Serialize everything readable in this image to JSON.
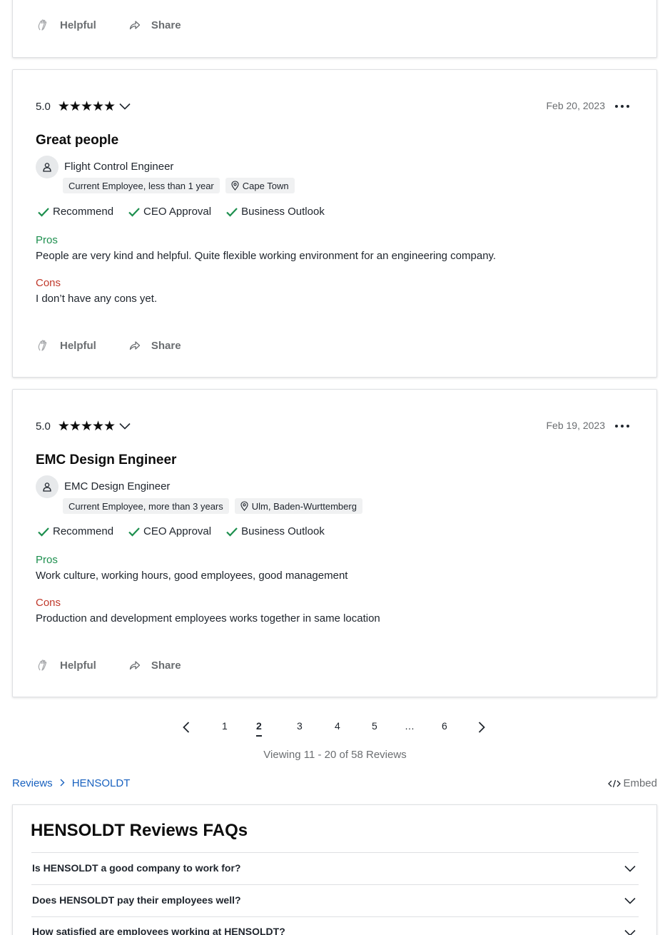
{
  "actions": {
    "helpful": "Helpful",
    "share": "Share"
  },
  "reviews": [
    {
      "rating": "5.0",
      "date": "Feb 20, 2023",
      "title": "Great people",
      "job_title": "Flight Control Engineer",
      "employment": "Current Employee, less than 1 year",
      "location": "Cape Town",
      "checks": [
        "Recommend",
        "CEO Approval",
        "Business Outlook"
      ],
      "pros_label": "Pros",
      "pros": "People are very kind and helpful. Quite flexible working environment for an engineering company.",
      "cons_label": "Cons",
      "cons": "I don’t have any cons yet."
    },
    {
      "rating": "5.0",
      "date": "Feb 19, 2023",
      "title": "EMC Design Engineer",
      "job_title": "EMC Design Engineer",
      "employment": "Current Employee, more than 3 years",
      "location": "Ulm, Baden-Wurttemberg",
      "checks": [
        "Recommend",
        "CEO Approval",
        "Business Outlook"
      ],
      "pros_label": "Pros",
      "pros": "Work culture, working hours, good employees, good management",
      "cons_label": "Cons",
      "cons": "Production and development employees works together in same location"
    }
  ],
  "pagination": {
    "pages": [
      "1",
      "2",
      "3",
      "4",
      "5",
      "…",
      "6"
    ],
    "current": "2",
    "viewing": "Viewing 11 - 20 of 58 Reviews"
  },
  "breadcrumb": {
    "reviews": "Reviews",
    "company": "HENSOLDT"
  },
  "embed": "Embed",
  "faq": {
    "title": "HENSOLDT Reviews FAQs",
    "questions": [
      "Is HENSOLDT a good company to work for?",
      "Does HENSOLDT pay their employees well?",
      "How satisfied are employees working at HENSOLDT?"
    ]
  },
  "colors": {
    "pros": "#1d8f4e",
    "cons": "#c0392b",
    "link": "#1861bf",
    "check": "#1d8f4e"
  }
}
